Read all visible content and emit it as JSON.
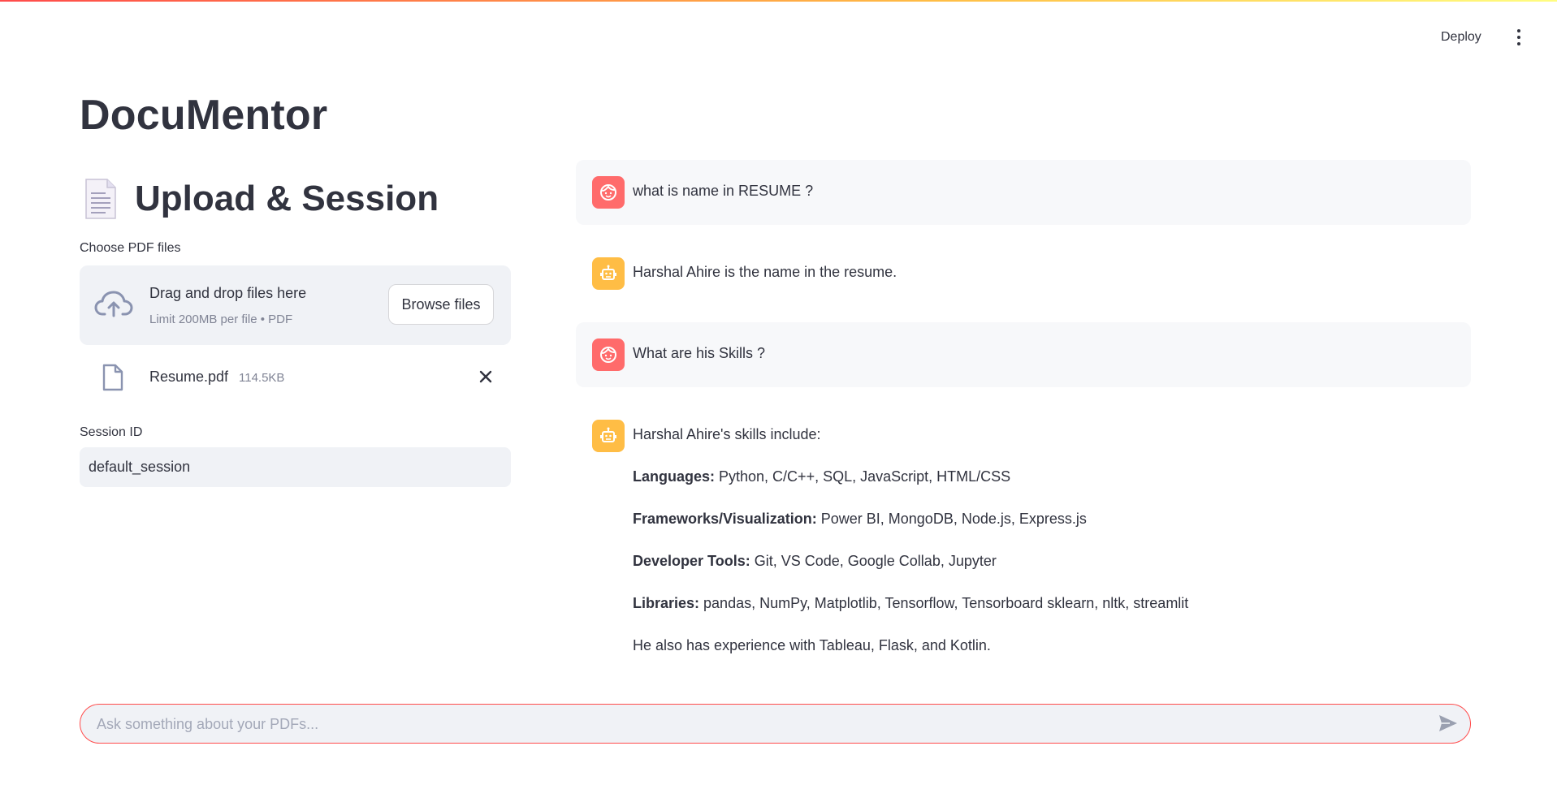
{
  "header": {
    "deploy_label": "Deploy"
  },
  "app": {
    "title": "DocuMentor"
  },
  "sidebar": {
    "section_title": "Upload & Session",
    "uploader_label": "Choose PDF files",
    "dropzone_title": "Drag and drop files here",
    "dropzone_subtitle": "Limit 200MB per file • PDF",
    "browse_label": "Browse files",
    "file": {
      "name": "Resume.pdf",
      "size": "114.5KB"
    },
    "session_label": "Session ID",
    "session_value": "default_session"
  },
  "chat": {
    "messages": [
      {
        "role": "user",
        "text": "what is name in RESUME ?"
      },
      {
        "role": "assistant",
        "text": "Harshal Ahire is the name in the resume."
      },
      {
        "role": "user",
        "text": "What are his Skills ?"
      },
      {
        "role": "assistant",
        "intro": "Harshal Ahire's skills include:",
        "items": [
          {
            "label": "Languages:",
            "value": " Python, C/C++, SQL, JavaScript, HTML/CSS"
          },
          {
            "label": "Frameworks/Visualization:",
            "value": " Power BI, MongoDB, Node.js, Express.js"
          },
          {
            "label": "Developer Tools:",
            "value": " Git, VS Code, Google Collab, Jupyter"
          },
          {
            "label": "Libraries:",
            "value": " pandas, NumPy, Matplotlib, Tensorflow, Tensorboard sklearn, nltk, streamlit"
          }
        ],
        "outro": "He also has experience with Tableau, Flask, and Kotlin."
      }
    ],
    "input_placeholder": "Ask something about your PDFs..."
  },
  "icons": {
    "menu": "kebab-menu-icon",
    "doc": "document-icon",
    "upload": "cloud-upload-icon",
    "file": "file-icon",
    "remove": "close-icon",
    "user_avatar": "user-face-icon",
    "bot_avatar": "robot-icon",
    "send": "send-icon"
  },
  "colors": {
    "accent": "#ff4b4b",
    "user_avatar": "#ff6b6b",
    "bot_avatar": "#ffbd45",
    "panel_bg": "#f0f2f6"
  }
}
